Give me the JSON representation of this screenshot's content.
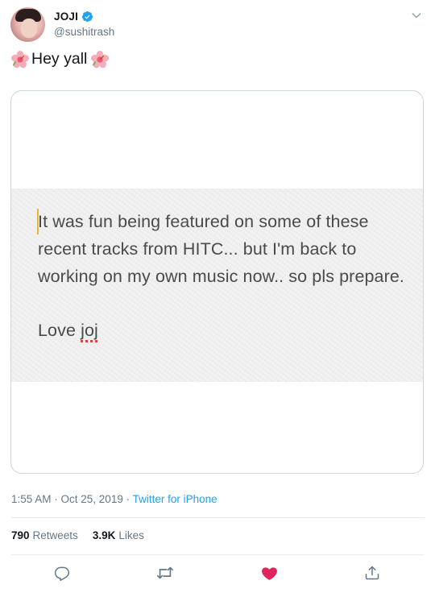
{
  "author": {
    "display_name": "JOJI",
    "handle": "@sushitrash",
    "avatar_icon": "avatar-photo",
    "verified_icon": "verified-badge-icon"
  },
  "tweet": {
    "text": "Hey yall",
    "leading_emoji": "hibiscus-icon",
    "trailing_emoji": "hibiscus-icon"
  },
  "media": {
    "note_body": "It was fun being featured on some of these recent tracks from HITC... but I'm back to working on my own music now.. so pls prepare.",
    "sign_prefix": "Love ",
    "sign_name": "joj"
  },
  "meta": {
    "time": "1:55 AM",
    "separator1": " · ",
    "date": "Oct 25, 2019",
    "separator2": " · ",
    "source": "Twitter for iPhone"
  },
  "stats": {
    "retweets_count": "790",
    "retweets_label": "Retweets",
    "likes_count": "3.9K",
    "likes_label": "Likes"
  },
  "actions": {
    "reply_icon": "reply-icon",
    "retweet_icon": "retweet-icon",
    "like_icon": "heart-icon",
    "share_icon": "share-icon"
  },
  "colors": {
    "link": "#1da1f2",
    "like_active": "#e0245e",
    "muted": "#657786",
    "verified": "#1da1f2"
  }
}
